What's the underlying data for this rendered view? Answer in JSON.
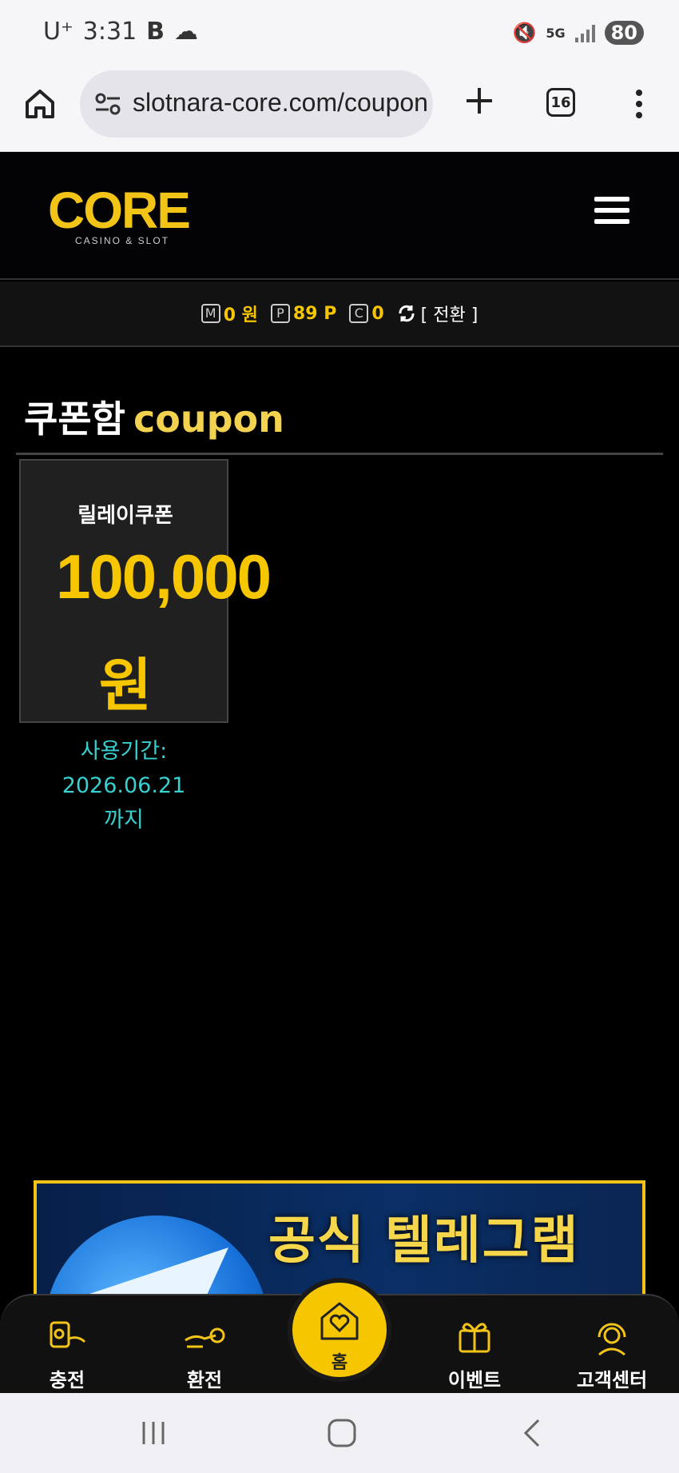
{
  "status_bar": {
    "carrier": "U⁺",
    "time": "3:31",
    "network": "5G",
    "battery": "80"
  },
  "browser": {
    "url": "slotnara-core.com/coupon",
    "tab_count": "16"
  },
  "site": {
    "logo_text": "CORE",
    "logo_subtext": "CASINO & SLOT"
  },
  "balance": {
    "money_badge": "M",
    "money_value": "0 원",
    "point_badge": "P",
    "point_value": "89 P",
    "casino_badge": "C",
    "casino_value": "0",
    "convert_label": "[ 전환 ]"
  },
  "page": {
    "title_ko": "쿠폰함",
    "title_en": "coupon"
  },
  "coupons": [
    {
      "name": "릴레이쿠폰",
      "amount": "100,000",
      "unit": "원",
      "expiry_label": "사용기간:",
      "expiry_date": "2026.06.21",
      "expiry_suffix": "까지"
    }
  ],
  "banner": {
    "text": "공식 텔레그램"
  },
  "bottom_nav": {
    "charge": "충전",
    "exchange": "환전",
    "home": "홈",
    "event": "이벤트",
    "support": "고객센터"
  },
  "colors": {
    "accent": "#f6c600",
    "expiry": "#39d0d0",
    "background": "#000000"
  }
}
